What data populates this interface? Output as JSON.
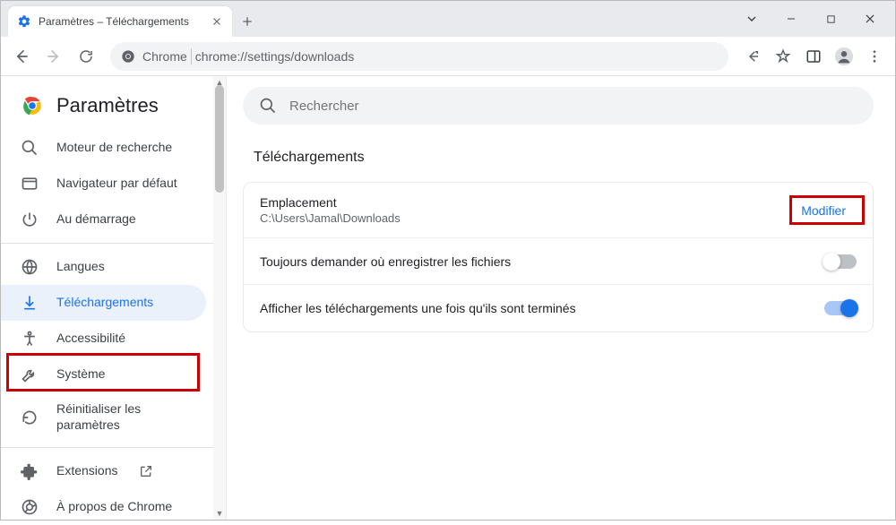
{
  "window": {
    "tab_title": "Paramètres – Téléchargements"
  },
  "omnibox": {
    "app_label": "Chrome",
    "url_text": "chrome://settings/downloads"
  },
  "sidebar": {
    "title": "Paramètres",
    "items": [
      {
        "label": "Moteur de recherche"
      },
      {
        "label": "Navigateur par défaut"
      },
      {
        "label": "Au démarrage"
      },
      {
        "label": "Langues"
      },
      {
        "label": "Téléchargements"
      },
      {
        "label": "Accessibilité"
      },
      {
        "label": "Système"
      },
      {
        "label": "Réinitialiser les paramètres"
      },
      {
        "label": "Extensions"
      },
      {
        "label": "À propos de Chrome"
      }
    ]
  },
  "search": {
    "placeholder": "Rechercher"
  },
  "section": {
    "title": "Téléchargements"
  },
  "location": {
    "label": "Emplacement",
    "path": "C:\\Users\\Jamal\\Downloads",
    "change_button": "Modifier"
  },
  "rows": {
    "ask_label": "Toujours demander où enregistrer les fichiers",
    "show_label": "Afficher les téléchargements une fois qu'ils sont terminés"
  }
}
